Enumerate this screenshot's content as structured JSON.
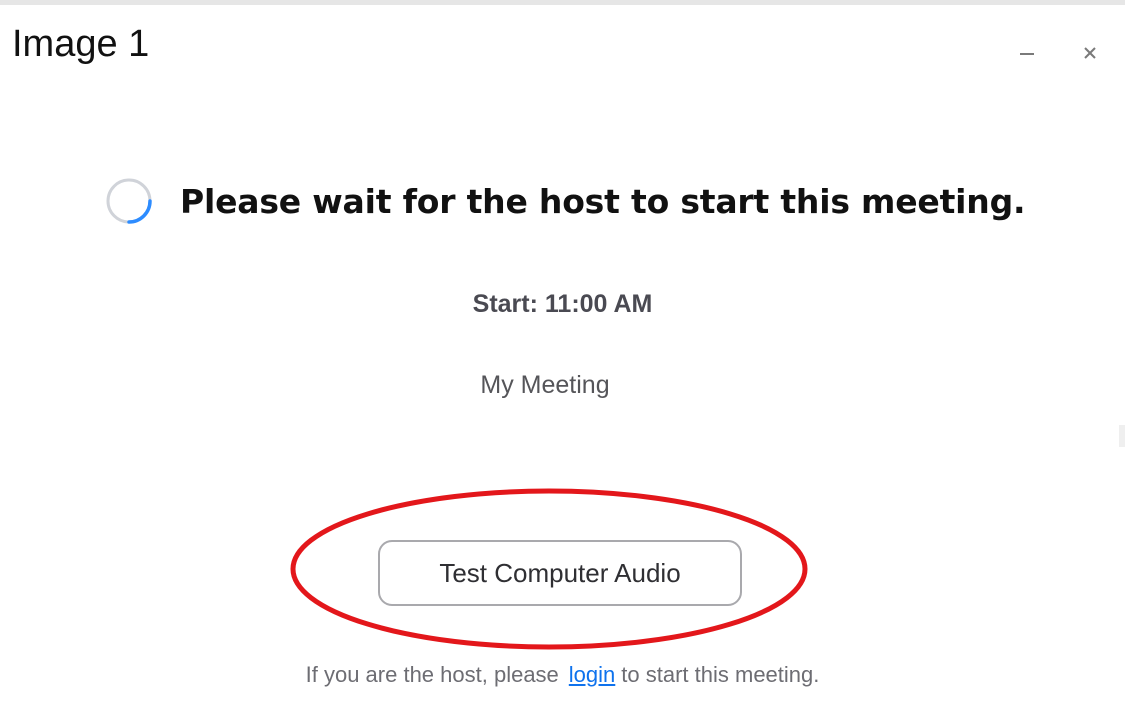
{
  "image_label": "Image 1",
  "window_controls": {
    "minimize_icon": "minimize-icon",
    "close_icon": "close-icon"
  },
  "main": {
    "headline": "Please wait for the host to start this meeting.",
    "spinner_icon": "loading-spinner-icon",
    "start_time": "Start: 11:00 AM",
    "meeting_name": "My Meeting",
    "test_audio_button": "Test Computer Audio",
    "host_note": {
      "prefix": "If you are the host, please",
      "link": "login",
      "suffix": "to start this meeting."
    }
  },
  "colors": {
    "link": "#0e72ed",
    "annotation": "#e3171b",
    "spinner_accent": "#2d8cff"
  }
}
